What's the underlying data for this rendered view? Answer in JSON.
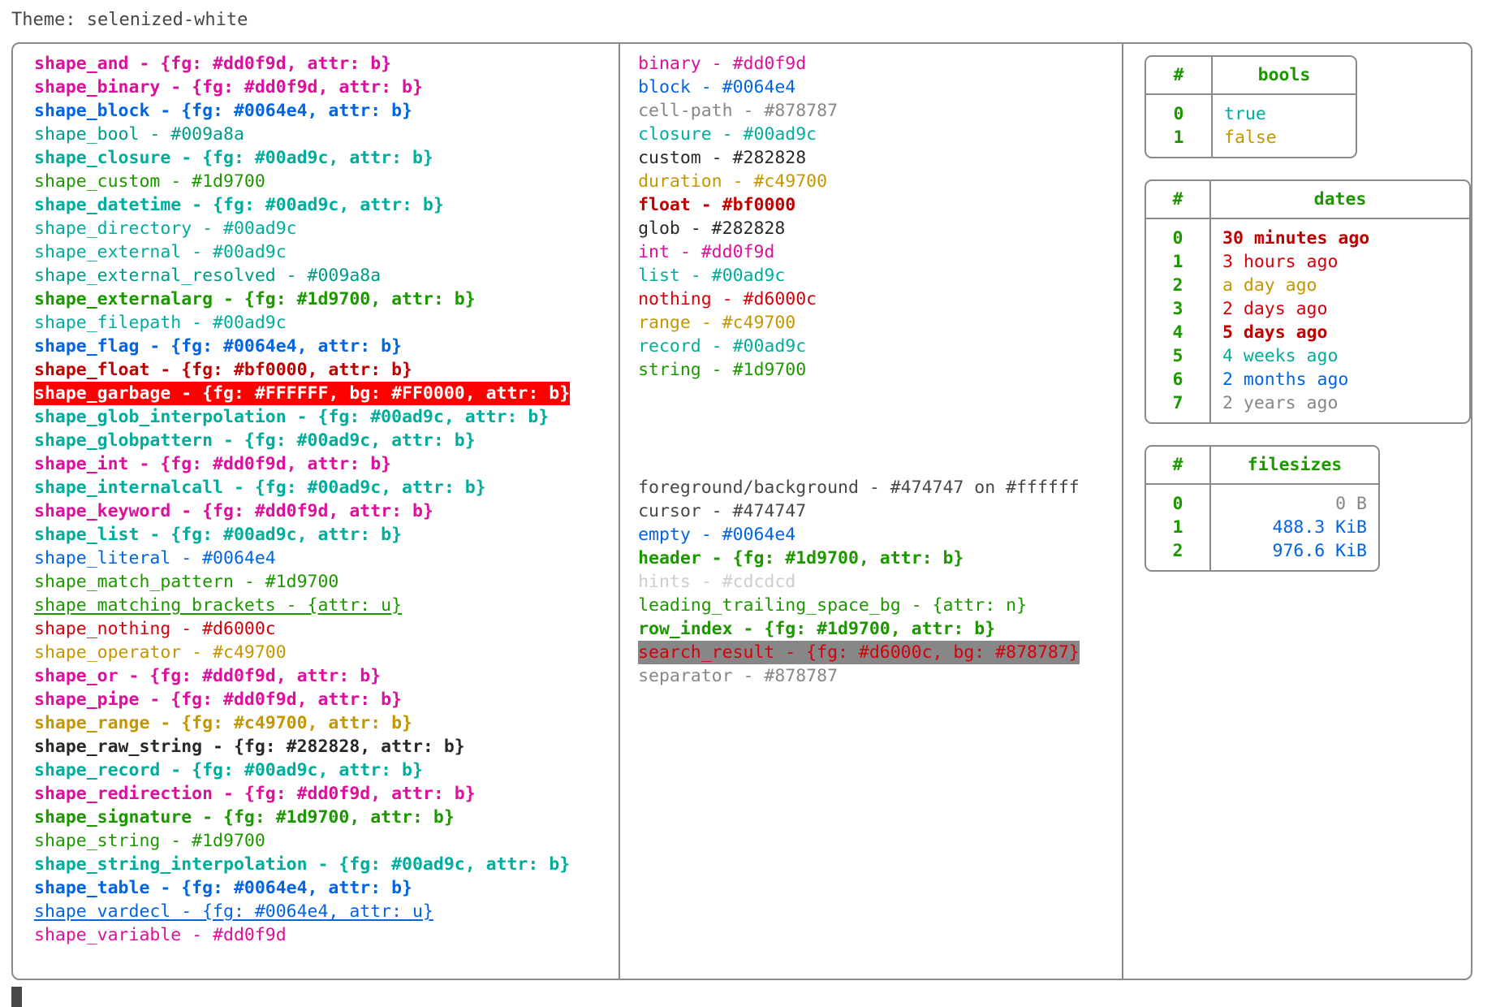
{
  "header": {
    "theme_label": "Theme: selenized-white"
  },
  "palette": {
    "foreground": "#474747",
    "background": "#ffffff",
    "magenta": "#dd0f9d",
    "blue": "#0064e4",
    "teal": "#009a8a",
    "cyan": "#00ad9c",
    "green": "#1d9700",
    "dark_red": "#bf0000",
    "red": "#d6000c",
    "amber": "#c49700",
    "black": "#282828",
    "gray": "#878787",
    "light_gray": "#cdcdcd",
    "garbage_fg": "#FFFFFF",
    "garbage_bg": "#FF0000",
    "border": "#8a8a8a"
  },
  "shapes": [
    {
      "text": "shape_and - {fg: #dd0f9d, attr: b}",
      "color": "#dd0f9d",
      "bold": true
    },
    {
      "text": "shape_binary - {fg: #dd0f9d, attr: b}",
      "color": "#dd0f9d",
      "bold": true
    },
    {
      "text": "shape_block - {fg: #0064e4, attr: b}",
      "color": "#0064e4",
      "bold": true
    },
    {
      "text": "shape_bool - #009a8a",
      "color": "#009a8a",
      "bold": false
    },
    {
      "text": "shape_closure - {fg: #00ad9c, attr: b}",
      "color": "#00ad9c",
      "bold": true
    },
    {
      "text": "shape_custom - #1d9700",
      "color": "#1d9700",
      "bold": false
    },
    {
      "text": "shape_datetime - {fg: #00ad9c, attr: b}",
      "color": "#00ad9c",
      "bold": true
    },
    {
      "text": "shape_directory - #00ad9c",
      "color": "#00ad9c",
      "bold": false
    },
    {
      "text": "shape_external - #00ad9c",
      "color": "#00ad9c",
      "bold": false
    },
    {
      "text": "shape_external_resolved - #009a8a",
      "color": "#009a8a",
      "bold": false
    },
    {
      "text": "shape_externalarg - {fg: #1d9700, attr: b}",
      "color": "#1d9700",
      "bold": true
    },
    {
      "text": "shape_filepath - #00ad9c",
      "color": "#00ad9c",
      "bold": false
    },
    {
      "text": "shape_flag - {fg: #0064e4, attr: b}",
      "color": "#0064e4",
      "bold": true
    },
    {
      "text": "shape_float - {fg: #bf0000, attr: b}",
      "color": "#bf0000",
      "bold": true
    },
    {
      "text": "shape_garbage - {fg: #FFFFFF, bg: #FF0000, attr: b}",
      "color": "#FFFFFF",
      "bg": "#FF0000",
      "bold": true
    },
    {
      "text": "shape_glob_interpolation - {fg: #00ad9c, attr: b}",
      "color": "#00ad9c",
      "bold": true
    },
    {
      "text": "shape_globpattern - {fg: #00ad9c, attr: b}",
      "color": "#00ad9c",
      "bold": true
    },
    {
      "text": "shape_int - {fg: #dd0f9d, attr: b}",
      "color": "#dd0f9d",
      "bold": true
    },
    {
      "text": "shape_internalcall - {fg: #00ad9c, attr: b}",
      "color": "#00ad9c",
      "bold": true
    },
    {
      "text": "shape_keyword - {fg: #dd0f9d, attr: b}",
      "color": "#dd0f9d",
      "bold": true
    },
    {
      "text": "shape_list - {fg: #00ad9c, attr: b}",
      "color": "#00ad9c",
      "bold": true
    },
    {
      "text": "shape_literal - #0064e4",
      "color": "#0064e4",
      "bold": false
    },
    {
      "text": "shape_match_pattern - #1d9700",
      "color": "#1d9700",
      "bold": false
    },
    {
      "text": "shape_matching_brackets - {attr: u}",
      "color": "#1d9700",
      "bold": false,
      "underline": true
    },
    {
      "text": "shape_nothing - #d6000c",
      "color": "#d6000c",
      "bold": false
    },
    {
      "text": "shape_operator - #c49700",
      "color": "#c49700",
      "bold": false
    },
    {
      "text": "shape_or - {fg: #dd0f9d, attr: b}",
      "color": "#dd0f9d",
      "bold": true
    },
    {
      "text": "shape_pipe - {fg: #dd0f9d, attr: b}",
      "color": "#dd0f9d",
      "bold": true
    },
    {
      "text": "shape_range - {fg: #c49700, attr: b}",
      "color": "#c49700",
      "bold": true
    },
    {
      "text": "shape_raw_string - {fg: #282828, attr: b}",
      "color": "#282828",
      "bold": true
    },
    {
      "text": "shape_record - {fg: #00ad9c, attr: b}",
      "color": "#00ad9c",
      "bold": true
    },
    {
      "text": "shape_redirection - {fg: #dd0f9d, attr: b}",
      "color": "#dd0f9d",
      "bold": true
    },
    {
      "text": "shape_signature - {fg: #1d9700, attr: b}",
      "color": "#1d9700",
      "bold": true
    },
    {
      "text": "shape_string - #1d9700",
      "color": "#1d9700",
      "bold": false
    },
    {
      "text": "shape_string_interpolation - {fg: #00ad9c, attr: b}",
      "color": "#00ad9c",
      "bold": true
    },
    {
      "text": "shape_table - {fg: #0064e4, attr: b}",
      "color": "#0064e4",
      "bold": true
    },
    {
      "text": "shape_vardecl - {fg: #0064e4, attr: u}",
      "color": "#0064e4",
      "bold": false,
      "underline": true
    },
    {
      "text": "shape_variable - #dd0f9d",
      "color": "#dd0f9d",
      "bold": false
    }
  ],
  "types": [
    {
      "text": "binary - #dd0f9d",
      "color": "#dd0f9d",
      "bold": false
    },
    {
      "text": "block - #0064e4",
      "color": "#0064e4",
      "bold": false
    },
    {
      "text": "cell-path - #878787",
      "color": "#878787",
      "bold": false
    },
    {
      "text": "closure - #00ad9c",
      "color": "#00ad9c",
      "bold": false
    },
    {
      "text": "custom - #282828",
      "color": "#282828",
      "bold": false
    },
    {
      "text": "duration - #c49700",
      "color": "#c49700",
      "bold": false
    },
    {
      "text": "float - #bf0000",
      "color": "#bf0000",
      "bold": true
    },
    {
      "text": "glob - #282828",
      "color": "#282828",
      "bold": false
    },
    {
      "text": "int - #dd0f9d",
      "color": "#dd0f9d",
      "bold": false
    },
    {
      "text": "list - #00ad9c",
      "color": "#00ad9c",
      "bold": false
    },
    {
      "text": "nothing - #d6000c",
      "color": "#d6000c",
      "bold": false
    },
    {
      "text": "range - #c49700",
      "color": "#c49700",
      "bold": false
    },
    {
      "text": "record - #00ad9c",
      "color": "#00ad9c",
      "bold": false
    },
    {
      "text": "string - #1d9700",
      "color": "#1d9700",
      "bold": false
    }
  ],
  "ui_elements": [
    {
      "text": "foreground/background - #474747 on #ffffff",
      "color": "#474747",
      "bold": false
    },
    {
      "text": "cursor - #474747",
      "color": "#474747",
      "bold": false
    },
    {
      "text": "empty - #0064e4",
      "color": "#0064e4",
      "bold": false
    },
    {
      "text": "header - {fg: #1d9700, attr: b}",
      "color": "#1d9700",
      "bold": true
    },
    {
      "text": "hints - #cdcdcd",
      "color": "#cdcdcd",
      "bold": false
    },
    {
      "text": "leading_trailing_space_bg - {attr: n}",
      "color": "#1d9700",
      "bold": false
    },
    {
      "text": "row_index - {fg: #1d9700, attr: b}",
      "color": "#1d9700",
      "bold": true
    },
    {
      "text": "search_result - {fg: #d6000c, bg: #878787}",
      "color": "#d6000c",
      "bg": "#878787",
      "bold": false
    },
    {
      "text": "separator - #878787",
      "color": "#878787",
      "bold": false
    }
  ],
  "tables": {
    "bools": {
      "headers": [
        "#",
        "bools"
      ],
      "rows": [
        {
          "index": "0",
          "value": "true",
          "color": "#00ad9c",
          "bold": false
        },
        {
          "index": "1",
          "value": "false",
          "color": "#c49700",
          "bold": false
        }
      ]
    },
    "dates": {
      "headers": [
        "#",
        "dates"
      ],
      "rows": [
        {
          "index": "0",
          "value": "30 minutes ago",
          "color": "#bf0000",
          "bold": true
        },
        {
          "index": "1",
          "value": "3 hours ago",
          "color": "#d6000c",
          "bold": false
        },
        {
          "index": "2",
          "value": "a day ago",
          "color": "#c49700",
          "bold": false
        },
        {
          "index": "3",
          "value": "2 days ago",
          "color": "#d6000c",
          "bold": false
        },
        {
          "index": "4",
          "value": "5 days ago",
          "color": "#bf0000",
          "bold": true
        },
        {
          "index": "5",
          "value": "4 weeks ago",
          "color": "#00ad9c",
          "bold": false
        },
        {
          "index": "6",
          "value": "2 months ago",
          "color": "#0064e4",
          "bold": false
        },
        {
          "index": "7",
          "value": "2 years ago",
          "color": "#878787",
          "bold": false
        }
      ]
    },
    "filesizes": {
      "headers": [
        "#",
        "filesizes"
      ],
      "rows": [
        {
          "index": "0",
          "value": "0 B",
          "color": "#878787",
          "bold": false
        },
        {
          "index": "1",
          "value": "488.3 KiB",
          "color": "#0064e4",
          "bold": false
        },
        {
          "index": "2",
          "value": "976.6 KiB",
          "color": "#0064e4",
          "bold": false
        }
      ]
    }
  }
}
